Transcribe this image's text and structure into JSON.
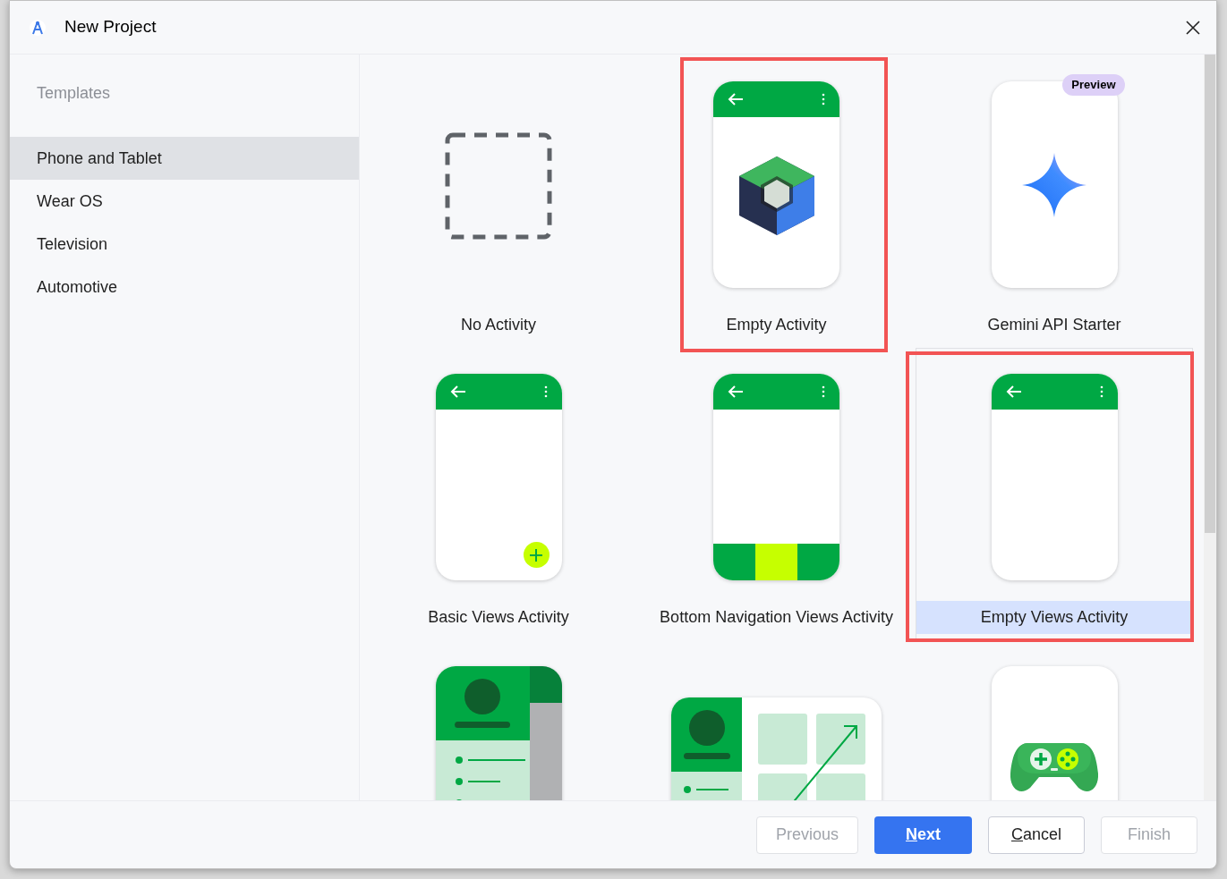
{
  "window": {
    "title": "New Project"
  },
  "sidebar": {
    "heading": "Templates",
    "items": [
      {
        "label": "Phone and Tablet",
        "selected": true
      },
      {
        "label": "Wear OS",
        "selected": false
      },
      {
        "label": "Television",
        "selected": false
      },
      {
        "label": "Automotive",
        "selected": false
      }
    ]
  },
  "templates": [
    {
      "kind": "none",
      "label": "No Activity",
      "selected": false,
      "annotated": false
    },
    {
      "kind": "compose",
      "label": "Empty Activity",
      "selected": false,
      "annotated": true
    },
    {
      "kind": "gemini",
      "label": "Gemini API Starter",
      "badge": "Preview",
      "selected": false,
      "annotated": false
    },
    {
      "kind": "basic",
      "label": "Basic Views Activity",
      "selected": false,
      "annotated": false
    },
    {
      "kind": "bottom_nav",
      "label": "Bottom Navigation Views Activity",
      "selected": false,
      "annotated": false
    },
    {
      "kind": "empty_views",
      "label": "Empty Views Activity",
      "selected": true,
      "annotated": true
    },
    {
      "kind": "drawer",
      "selected": false,
      "annotated": false
    },
    {
      "kind": "responsive",
      "selected": false,
      "annotated": false
    },
    {
      "kind": "game",
      "selected": false,
      "annotated": false
    }
  ],
  "buttons": [
    {
      "label": "Previous",
      "kind": "plain",
      "disabled": true
    },
    {
      "label": "Next",
      "kind": "primary",
      "disabled": false,
      "first_letter_underlined": true
    },
    {
      "label": "Cancel",
      "kind": "plain",
      "disabled": false,
      "first_letter_underlined": true
    },
    {
      "label": "Finish",
      "kind": "plain",
      "disabled": true
    }
  ]
}
